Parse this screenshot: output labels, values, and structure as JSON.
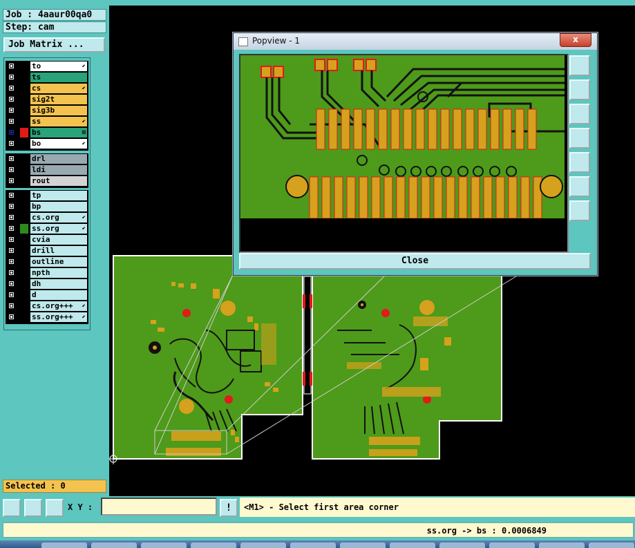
{
  "header": {
    "job_label": "Job : 4aaur00qa0",
    "step_label": "Step: cam"
  },
  "toolbar": {
    "job_matrix_label": "Job Matrix ..."
  },
  "layers": {
    "group1": [
      {
        "name": "to",
        "color": "#ffffff",
        "flag": "⬋",
        "mark": ""
      },
      {
        "name": "ts",
        "color": "#2aa37a",
        "flag": "",
        "mark": ""
      },
      {
        "name": "cs",
        "color": "#f4c34f",
        "flag": "⬋",
        "mark": ""
      },
      {
        "name": "sig2t",
        "color": "#f4c34f",
        "flag": "",
        "mark": ""
      },
      {
        "name": "sig3b",
        "color": "#f4c34f",
        "flag": "",
        "mark": ""
      },
      {
        "name": "ss",
        "color": "#f4c34f",
        "flag": "⬋",
        "mark": ""
      },
      {
        "name": "bs",
        "color": "#2aa37a",
        "flag": "⊞",
        "mark": "#e21a1a"
      },
      {
        "name": "bo",
        "color": "#ffffff",
        "flag": "⬋",
        "mark": ""
      }
    ],
    "group2": [
      {
        "name": "drl",
        "color": "#98a9b1",
        "flag": "",
        "mark": ""
      },
      {
        "name": "ldi",
        "color": "#98a9b1",
        "flag": "",
        "mark": ""
      },
      {
        "name": "rout",
        "color": "#d3d3d3",
        "flag": "",
        "mark": ""
      }
    ],
    "group3": [
      {
        "name": "tp",
        "color": "#bfe9ec",
        "flag": "",
        "mark": ""
      },
      {
        "name": "bp",
        "color": "#bfe9ec",
        "flag": "",
        "mark": ""
      },
      {
        "name": "cs.org",
        "color": "#bfe9ec",
        "flag": "⬋",
        "mark": ""
      },
      {
        "name": "ss.org",
        "color": "#bfe9ec",
        "flag": "⬋",
        "mark": "#2f8a1e"
      },
      {
        "name": "cvia",
        "color": "#bfe9ec",
        "flag": "",
        "mark": ""
      },
      {
        "name": "drill",
        "color": "#bfe9ec",
        "flag": "",
        "mark": ""
      },
      {
        "name": "outline",
        "color": "#bfe9ec",
        "flag": "",
        "mark": ""
      },
      {
        "name": "npth",
        "color": "#bfe9ec",
        "flag": "",
        "mark": ""
      },
      {
        "name": "dh",
        "color": "#bfe9ec",
        "flag": "",
        "mark": ""
      },
      {
        "name": "d",
        "color": "#bfe9ec",
        "flag": "",
        "mark": ""
      },
      {
        "name": "cs.org+++",
        "color": "#bfe9ec",
        "flag": "⬋",
        "mark": ""
      },
      {
        "name": "ss.org+++",
        "color": "#bfe9ec",
        "flag": "⬋",
        "mark": ""
      }
    ]
  },
  "selection": {
    "selected_label": "Selected : 0"
  },
  "popview": {
    "title": "Popview - 1",
    "close_x": "x",
    "close_button": "Close"
  },
  "bottom": {
    "xy_label": "X Y :",
    "xy_value": "",
    "hint_icon": "!",
    "prompt": "<M1> - Select first area corner",
    "status": "ss.org -> bs : 0.0006849"
  },
  "colors": {
    "panel": "#5cc6bf",
    "board_green": "#4e9a1a",
    "copper": "#d6a11d",
    "accent_red": "#e21a1a"
  }
}
